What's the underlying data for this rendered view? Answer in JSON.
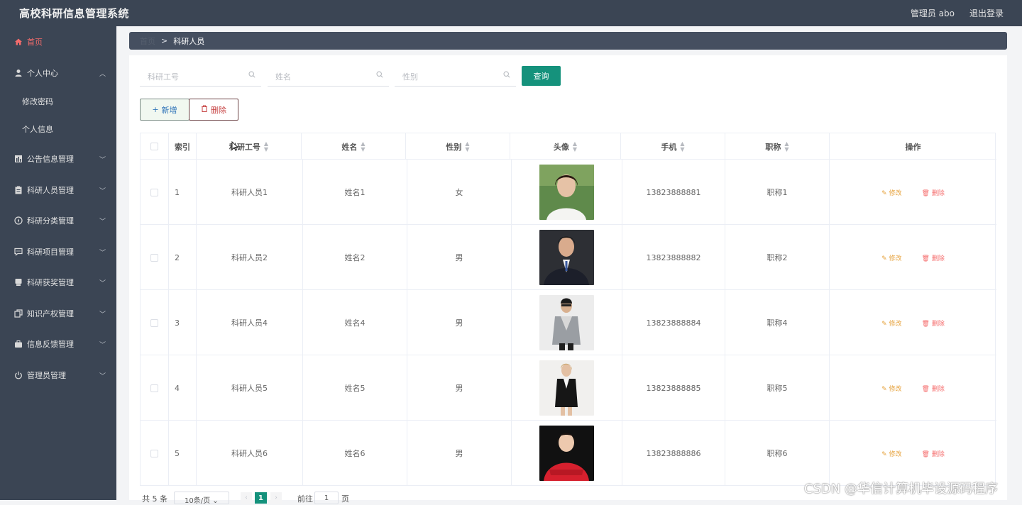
{
  "header": {
    "title": "高校科研信息管理系统",
    "user": "管理员 abo",
    "logout": "退出登录"
  },
  "sidebar": {
    "items": [
      {
        "label": "首页",
        "icon": "home-icon",
        "active": true
      },
      {
        "label": "个人中心",
        "icon": "user-icon",
        "expanded": true,
        "children": [
          "修改密码",
          "个人信息"
        ]
      },
      {
        "label": "公告信息管理",
        "icon": "chart-icon"
      },
      {
        "label": "科研人员管理",
        "icon": "clipboard-icon"
      },
      {
        "label": "科研分类管理",
        "icon": "compass-icon"
      },
      {
        "label": "科研项目管理",
        "icon": "chat-icon"
      },
      {
        "label": "科研获奖管理",
        "icon": "award-icon"
      },
      {
        "label": "知识产权管理",
        "icon": "copy-icon"
      },
      {
        "label": "信息反馈管理",
        "icon": "briefcase-icon"
      },
      {
        "label": "管理员管理",
        "icon": "power-icon"
      }
    ]
  },
  "breadcrumb": {
    "home": "首页",
    "sep": ">",
    "current": "科研人员"
  },
  "search": {
    "fields": [
      {
        "placeholder": "科研工号"
      },
      {
        "placeholder": "姓名"
      },
      {
        "placeholder": "性别"
      }
    ],
    "query_label": "查询"
  },
  "actions": {
    "add_label": "新增",
    "delete_label": "删除"
  },
  "table": {
    "columns": [
      "索引",
      "科研工号",
      "姓名",
      "性别",
      "头像",
      "手机",
      "职称",
      "操作"
    ],
    "rows": [
      {
        "index": "1",
        "id": "科研人员1",
        "name": "姓名1",
        "gender": "女",
        "phone": "13823888881",
        "title": "职称1"
      },
      {
        "index": "2",
        "id": "科研人员2",
        "name": "姓名2",
        "gender": "男",
        "phone": "13823888882",
        "title": "职称2"
      },
      {
        "index": "3",
        "id": "科研人员4",
        "name": "姓名4",
        "gender": "男",
        "phone": "13823888884",
        "title": "职称4"
      },
      {
        "index": "4",
        "id": "科研人员5",
        "name": "姓名5",
        "gender": "男",
        "phone": "13823888885",
        "title": "职称5"
      },
      {
        "index": "5",
        "id": "科研人员6",
        "name": "姓名6",
        "gender": "男",
        "phone": "13823888886",
        "title": "职称6"
      }
    ],
    "edit_label": "修改",
    "delete_label": "删除"
  },
  "pagination": {
    "total": "共 5 条",
    "size": "10条/页",
    "current_page": "1",
    "goto_prefix": "前往",
    "goto_value": "1",
    "goto_suffix": "页"
  },
  "watermark": "CSDN @华信计算机毕设源码程序",
  "colors": {
    "accent": "#15927c",
    "sidebar": "#3b4554",
    "active": "#f56c6c",
    "edit": "#e6a23c"
  }
}
